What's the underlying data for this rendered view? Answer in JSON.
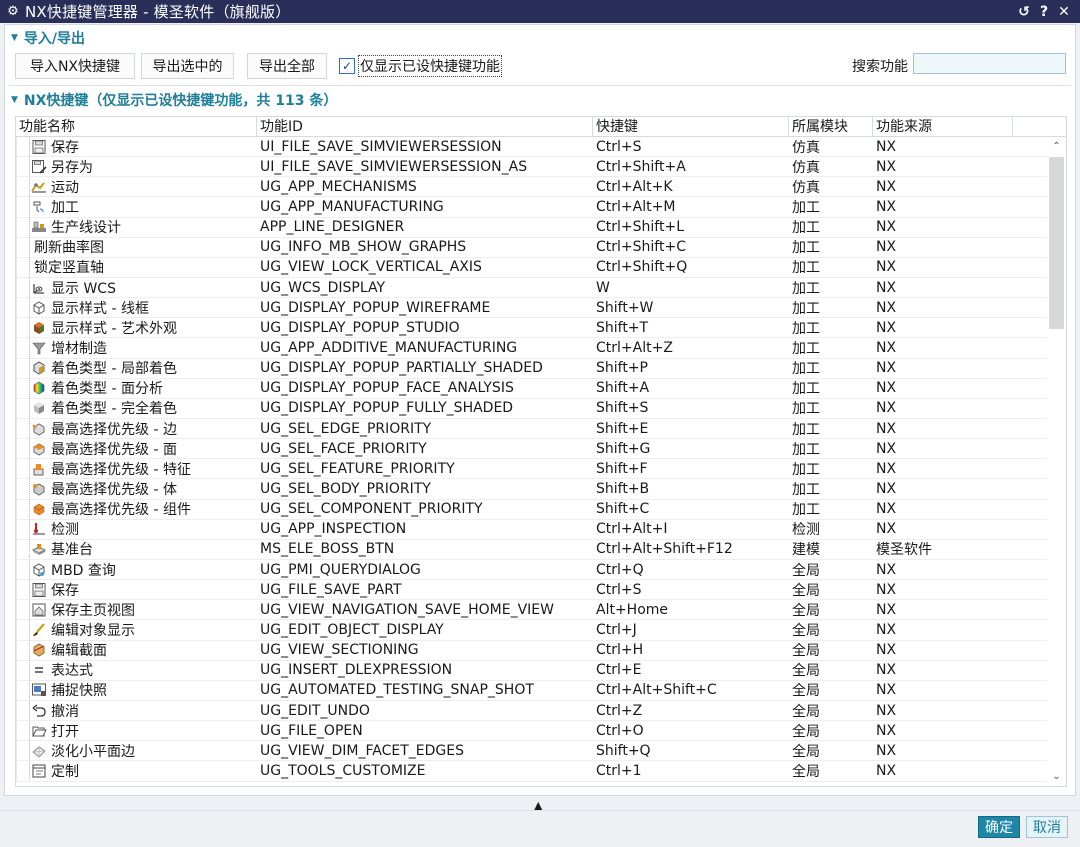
{
  "window": {
    "title": "NX快捷键管理器 - 模圣软件（旗舰版）",
    "gear_icon": "gear-icon",
    "reset_icon": "↺",
    "help_icon": "?",
    "close_icon": "✕"
  },
  "import_export": {
    "section_title": "导入/导出",
    "import_button": "导入NX快捷键",
    "export_selected_button": "导出选中的",
    "export_all_button": "导出全部",
    "checkbox_label": "仅显示已设快捷键功能",
    "checkbox_checked": true,
    "search_label": "搜索功能",
    "search_value": ""
  },
  "shortcuts": {
    "section_title": "NX快捷键（仅显示已设快捷键功能，共 113 条）",
    "columns": [
      "功能名称",
      "功能ID",
      "快捷键",
      "所属模块",
      "功能来源"
    ],
    "rows": [
      {
        "name": "保存",
        "id": "UI_FILE_SAVE_SIMVIEWERSESSION",
        "shortcut": "Ctrl+S",
        "module": "仿真",
        "source": "NX",
        "icon": "save"
      },
      {
        "name": "另存为",
        "id": "UI_FILE_SAVE_SIMVIEWERSESSION_AS",
        "shortcut": "Ctrl+Shift+A",
        "module": "仿真",
        "source": "NX",
        "icon": "saveas"
      },
      {
        "name": "运动",
        "id": "UG_APP_MECHANISMS",
        "shortcut": "Ctrl+Alt+K",
        "module": "仿真",
        "source": "NX",
        "icon": "motion"
      },
      {
        "name": "加工",
        "id": "UG_APP_MANUFACTURING",
        "shortcut": "Ctrl+Alt+M",
        "module": "加工",
        "source": "NX",
        "icon": "machining"
      },
      {
        "name": "生产线设计",
        "id": "APP_LINE_DESIGNER",
        "shortcut": "Ctrl+Shift+L",
        "module": "加工",
        "source": "NX",
        "icon": "line"
      },
      {
        "name": "刷新曲率图",
        "id": "UG_INFO_MB_SHOW_GRAPHS",
        "shortcut": "Ctrl+Shift+C",
        "module": "加工",
        "source": "NX",
        "icon": "none"
      },
      {
        "name": "锁定竖直轴",
        "id": "UG_VIEW_LOCK_VERTICAL_AXIS",
        "shortcut": "Ctrl+Shift+Q",
        "module": "加工",
        "source": "NX",
        "icon": "none"
      },
      {
        "name": "显示 WCS",
        "id": "UG_WCS_DISPLAY",
        "shortcut": "W",
        "module": "加工",
        "source": "NX",
        "icon": "wcs"
      },
      {
        "name": "显示样式 - 线框",
        "id": "UG_DISPLAY_POPUP_WIREFRAME",
        "shortcut": "Shift+W",
        "module": "加工",
        "source": "NX",
        "icon": "wire"
      },
      {
        "name": "显示样式 - 艺术外观",
        "id": "UG_DISPLAY_POPUP_STUDIO",
        "shortcut": "Shift+T",
        "module": "加工",
        "source": "NX",
        "icon": "studio"
      },
      {
        "name": "增材制造",
        "id": "UG_APP_ADDITIVE_MANUFACTURING",
        "shortcut": "Ctrl+Alt+Z",
        "module": "加工",
        "source": "NX",
        "icon": "additive"
      },
      {
        "name": "着色类型 - 局部着色",
        "id": "UG_DISPLAY_POPUP_PARTIALLY_SHADED",
        "shortcut": "Shift+P",
        "module": "加工",
        "source": "NX",
        "icon": "partial"
      },
      {
        "name": "着色类型 - 面分析",
        "id": "UG_DISPLAY_POPUP_FACE_ANALYSIS",
        "shortcut": "Shift+A",
        "module": "加工",
        "source": "NX",
        "icon": "face"
      },
      {
        "name": "着色类型 - 完全着色",
        "id": "UG_DISPLAY_POPUP_FULLY_SHADED",
        "shortcut": "Shift+S",
        "module": "加工",
        "source": "NX",
        "icon": "shaded"
      },
      {
        "name": "最高选择优先级 - 边",
        "id": "UG_SEL_EDGE_PRIORITY",
        "shortcut": "Shift+E",
        "module": "加工",
        "source": "NX",
        "icon": "edge"
      },
      {
        "name": "最高选择优先级 - 面",
        "id": "UG_SEL_FACE_PRIORITY",
        "shortcut": "Shift+G",
        "module": "加工",
        "source": "NX",
        "icon": "selface"
      },
      {
        "name": "最高选择优先级 - 特征",
        "id": "UG_SEL_FEATURE_PRIORITY",
        "shortcut": "Shift+F",
        "module": "加工",
        "source": "NX",
        "icon": "feature"
      },
      {
        "name": "最高选择优先级 - 体",
        "id": "UG_SEL_BODY_PRIORITY",
        "shortcut": "Shift+B",
        "module": "加工",
        "source": "NX",
        "icon": "body"
      },
      {
        "name": "最高选择优先级 - 组件",
        "id": "UG_SEL_COMPONENT_PRIORITY",
        "shortcut": "Shift+C",
        "module": "加工",
        "source": "NX",
        "icon": "component"
      },
      {
        "name": "检测",
        "id": "UG_APP_INSPECTION",
        "shortcut": "Ctrl+Alt+I",
        "module": "检测",
        "source": "NX",
        "icon": "inspect"
      },
      {
        "name": "基准台",
        "id": "MS_ELE_BOSS_BTN",
        "shortcut": "Ctrl+Alt+Shift+F12",
        "module": "建模",
        "source": "模圣软件",
        "icon": "boss"
      },
      {
        "name": "MBD 查询",
        "id": "UG_PMI_QUERYDIALOG",
        "shortcut": "Ctrl+Q",
        "module": "全局",
        "source": "NX",
        "icon": "mbd"
      },
      {
        "name": "保存",
        "id": "UG_FILE_SAVE_PART",
        "shortcut": "Ctrl+S",
        "module": "全局",
        "source": "NX",
        "icon": "save"
      },
      {
        "name": "保存主页视图",
        "id": "UG_VIEW_NAVIGATION_SAVE_HOME_VIEW",
        "shortcut": "Alt+Home",
        "module": "全局",
        "source": "NX",
        "icon": "homeview"
      },
      {
        "name": "编辑对象显示",
        "id": "UG_EDIT_OBJECT_DISPLAY",
        "shortcut": "Ctrl+J",
        "module": "全局",
        "source": "NX",
        "icon": "brush"
      },
      {
        "name": "编辑截面",
        "id": "UG_VIEW_SECTIONING",
        "shortcut": "Ctrl+H",
        "module": "全局",
        "source": "NX",
        "icon": "section"
      },
      {
        "name": "表达式",
        "id": "UG_INSERT_DLEXPRESSION",
        "shortcut": "Ctrl+E",
        "module": "全局",
        "source": "NX",
        "icon": "expr"
      },
      {
        "name": "捕捉快照",
        "id": "UG_AUTOMATED_TESTING_SNAP_SHOT",
        "shortcut": "Ctrl+Alt+Shift+C",
        "module": "全局",
        "source": "NX",
        "icon": "snap"
      },
      {
        "name": "撤消",
        "id": "UG_EDIT_UNDO",
        "shortcut": "Ctrl+Z",
        "module": "全局",
        "source": "NX",
        "icon": "undo"
      },
      {
        "name": "打开",
        "id": "UG_FILE_OPEN",
        "shortcut": "Ctrl+O",
        "module": "全局",
        "source": "NX",
        "icon": "open"
      },
      {
        "name": "淡化小平面边",
        "id": "UG_VIEW_DIM_FACET_EDGES",
        "shortcut": "Shift+Q",
        "module": "全局",
        "source": "NX",
        "icon": "facet"
      },
      {
        "name": "定制",
        "id": "UG_TOOLS_CUSTOMIZE",
        "shortcut": "Ctrl+1",
        "module": "全局",
        "source": "NX",
        "icon": "customize"
      }
    ]
  },
  "footer": {
    "ok_button": "确定",
    "cancel_button": "取消",
    "collapse_icon": "▲",
    "accent_color": "#1f86a6"
  }
}
